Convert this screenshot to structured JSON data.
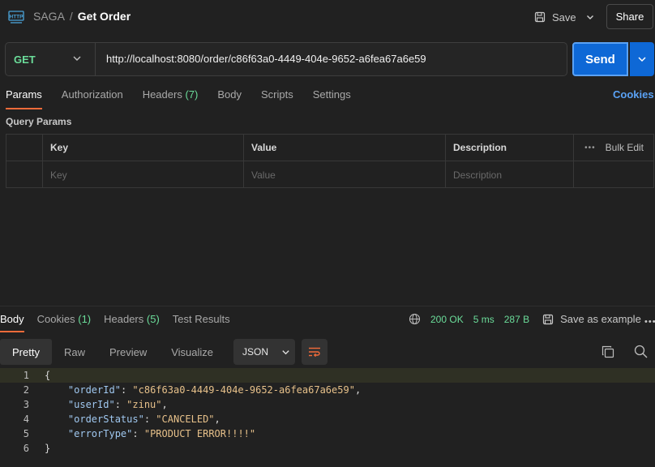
{
  "header": {
    "workspace": "SAGA",
    "separator": "/",
    "request_name": "Get Order",
    "save_label": "Save",
    "share_label": "Share"
  },
  "request": {
    "method": "GET",
    "url": "http://localhost:8080/order/c86f63a0-4449-404e-9652-a6fea67a6e59",
    "send_label": "Send"
  },
  "request_tabs": [
    {
      "label": "Params",
      "count": ""
    },
    {
      "label": "Authorization",
      "count": ""
    },
    {
      "label": "Headers",
      "count": "(7)"
    },
    {
      "label": "Body",
      "count": ""
    },
    {
      "label": "Scripts",
      "count": ""
    },
    {
      "label": "Settings",
      "count": ""
    }
  ],
  "cookies_link": "Cookies",
  "query_params": {
    "title": "Query Params",
    "headers": {
      "key": "Key",
      "value": "Value",
      "description": "Description",
      "bulk_edit": "Bulk Edit"
    },
    "placeholders": {
      "key": "Key",
      "value": "Value",
      "description": "Description"
    }
  },
  "response_tabs": [
    {
      "label": "Body",
      "count": ""
    },
    {
      "label": "Cookies",
      "count": "(1)"
    },
    {
      "label": "Headers",
      "count": "(5)"
    },
    {
      "label": "Test Results",
      "count": ""
    }
  ],
  "response_status": {
    "status": "200 OK",
    "time": "5 ms",
    "size": "287 B",
    "save_example": "Save as example"
  },
  "view_modes": [
    "Pretty",
    "Raw",
    "Preview",
    "Visualize"
  ],
  "format": "JSON",
  "response_lines": [
    {
      "n": "1",
      "t": "{"
    },
    {
      "n": "2",
      "t": "    \"orderId\": \"c86f63a0-4449-404e-9652-a6fea67a6e59\","
    },
    {
      "n": "3",
      "t": "    \"userId\": \"zinu\","
    },
    {
      "n": "4",
      "t": "    \"orderStatus\": \"CANCELED\","
    },
    {
      "n": "5",
      "t": "    \"errorType\": \"PRODUCT ERROR!!!!\""
    },
    {
      "n": "6",
      "t": "}"
    }
  ],
  "colors": {
    "accent": "#0e68d6",
    "method": "#6bdd9a",
    "tab_active": "#f26b3a",
    "link": "#5aa2f5"
  }
}
